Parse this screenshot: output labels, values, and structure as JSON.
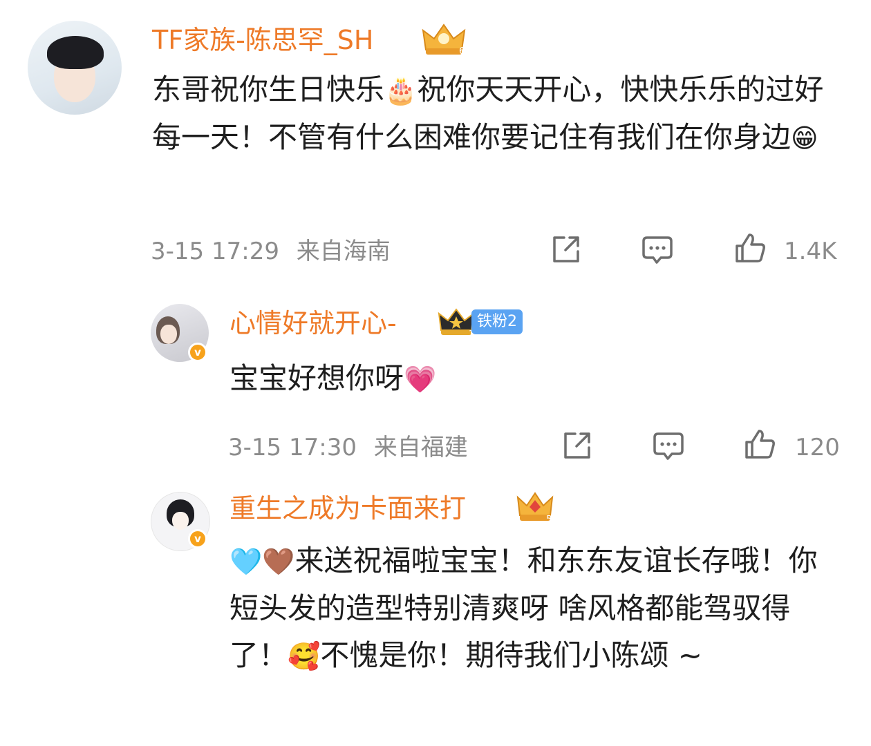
{
  "comments": [
    {
      "username": "TF家族-陈思罕_SH",
      "crown_level": "6",
      "text_parts": [
        "东哥祝你生日快乐",
        "🎂",
        "祝你天天开心，快快乐乐的过好每一天！不管有什么困难你要记住有我们在你身边",
        "😁"
      ],
      "timestamp": "3-15 17:29",
      "location": "来自海南",
      "likes": "1.4K"
    },
    {
      "username": "心情好就开心-",
      "crown_level": "1",
      "fan_badge": "铁粉2",
      "verified": "v",
      "text_parts": [
        "宝宝好想你呀",
        "💗"
      ],
      "timestamp": "3-15 17:30",
      "location": "来自福建",
      "likes": "120"
    },
    {
      "username": "重生之成为卡面来打",
      "crown_level": "5",
      "verified": "v",
      "text_parts": [
        "🩵",
        "🤎",
        "来送祝福啦宝宝！和东东友谊长存哦！你短头发的造型特别清爽呀 啥风格都能驾驭得了！",
        "🥰",
        "不愧是你！期待我们小陈颂 ~"
      ],
      "timestamp": "",
      "location": "",
      "likes": ""
    }
  ],
  "icons": [
    "share-icon",
    "comment-icon",
    "like-icon",
    "crown-icon",
    "verified-icon"
  ],
  "colors": {
    "username": "#ee7a28",
    "meta": "#8b8b8b",
    "fan_badge": "#5aa3f2",
    "verified": "#f7a21b"
  }
}
